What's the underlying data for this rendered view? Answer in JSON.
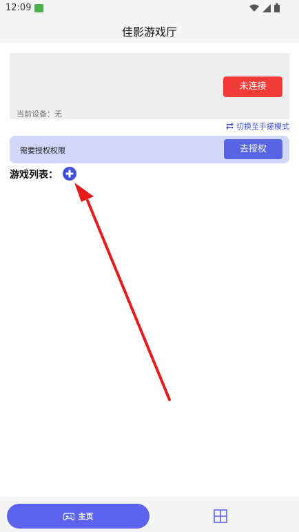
{
  "status_bar": {
    "time": "12:09",
    "icons": [
      "app-notification-icon",
      "wifi-icon",
      "signal-icon",
      "battery-icon"
    ]
  },
  "header": {
    "title": "佳影游戏厅"
  },
  "device": {
    "connect_button": "未连接",
    "current_device": "当前设备：无"
  },
  "switch_mode": {
    "label": "切换至手搓模式",
    "icon": "repeat-icon"
  },
  "authorization": {
    "message": "需要授权权限",
    "button": "去授权"
  },
  "game_list": {
    "label": "游戏列表：",
    "add_icon": "plus-circle-icon"
  },
  "bottom_nav": {
    "home_label": "主页",
    "home_icon": "gamepad-icon",
    "other_icon": "grid-icon"
  },
  "colors": {
    "connect_red": "#f23b36",
    "accent_blue": "#5765e4",
    "auth_bar_bg": "#d1d8f9",
    "annotation_arrow": "#e8191a"
  }
}
